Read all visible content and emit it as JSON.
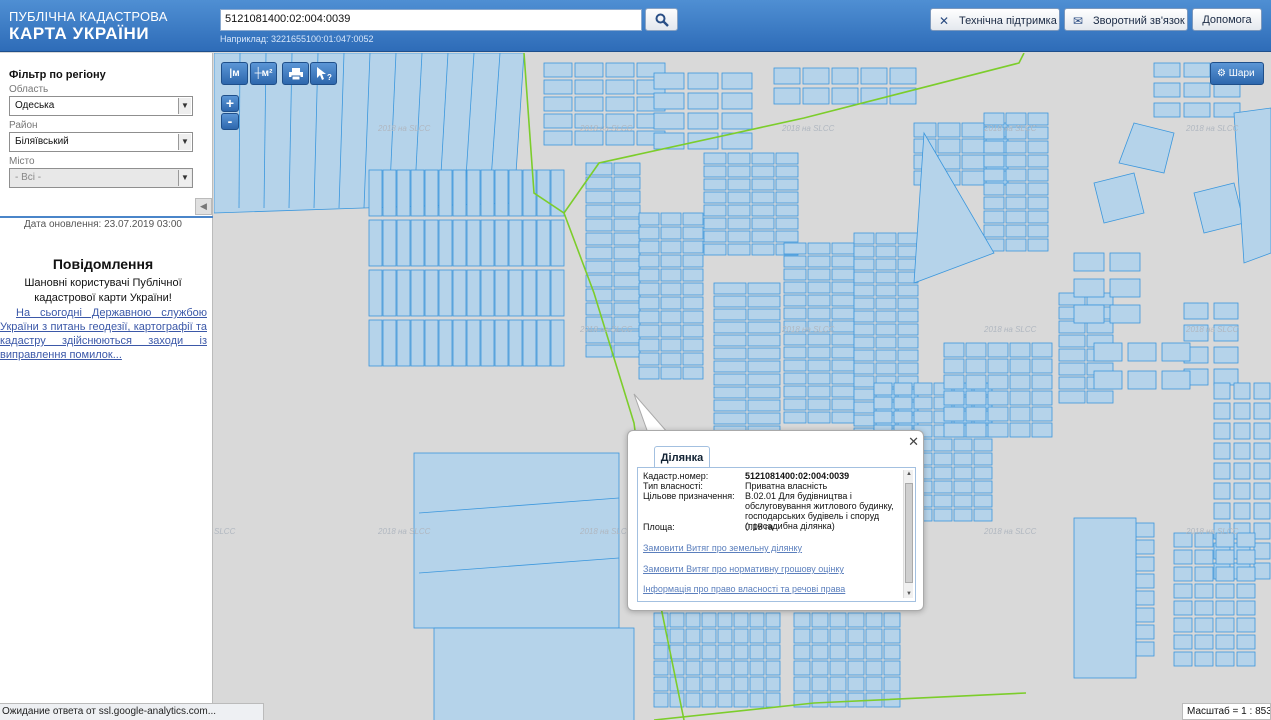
{
  "header": {
    "logo_line1": "ПУБЛІЧНА КАДАСТРОВА",
    "logo_line2": "КАРТА УКРАЇНИ",
    "search_value": "5121081400:02:004:0039",
    "example_text": "Наприклад: 3221655100:01:047:0052",
    "buttons": {
      "support": "Технічна підтримка",
      "feedback": "Зворотний зв'язок",
      "help": "Допомога"
    }
  },
  "sidebar": {
    "filter_title": "Фільтр по регіону",
    "region_label": "Область",
    "region_value": "Одеська",
    "district_label": "Район",
    "district_value": "Біляївський",
    "city_label": "Місто",
    "city_value": "- Всі -",
    "updated": "Дата оновлення: 23.07.2019 03:00",
    "notice_title": "Повідомлення",
    "notice_greeting": "Шановні користувачі Публічної кадастрової карти України!",
    "notice_link": "На сьогодні Державною службою України з питань геодезії, картографії та кадастру здійснюються заходи із виправлення помилок..."
  },
  "map": {
    "tools": {
      "measure_length": "|м",
      "measure_area": "┼м²",
      "zoom_in": "+",
      "zoom_out": "-"
    },
    "layers_label": "Шари",
    "watermark": "2018 на SLCC",
    "watermark_short": "SLCC"
  },
  "popup": {
    "tab_label": "Ділянка",
    "close_symbol": "✕",
    "fields": [
      {
        "key": "Кадастр.номер:",
        "value": "5121081400:02:004:0039"
      },
      {
        "key": "Тип власності:",
        "value": "Приватна власність"
      },
      {
        "key": "Цільове призначення:",
        "value": "В.02.01 Для будівництва і обслуговування житлового будинку, господарських будівель і споруд (присадибна ділянка)"
      },
      {
        "key": "Площа:",
        "value": "0.15 га"
      }
    ],
    "links": [
      "Замовити Витяг про земельну ділянку",
      "Замовити Витяг про нормативну грошову оцінку",
      "Інформація про право власності та речові права"
    ]
  },
  "status_bar": "Ожидание ответа от ssl.google-analytics.com...",
  "scale_text": "Масштаб = 1 : 8531",
  "colors": {
    "header": "#3b7cc6",
    "parcel_fill": "#b5d3ea",
    "parcel_stroke": "#3b97dd",
    "boundary": "#7ccd2b"
  }
}
